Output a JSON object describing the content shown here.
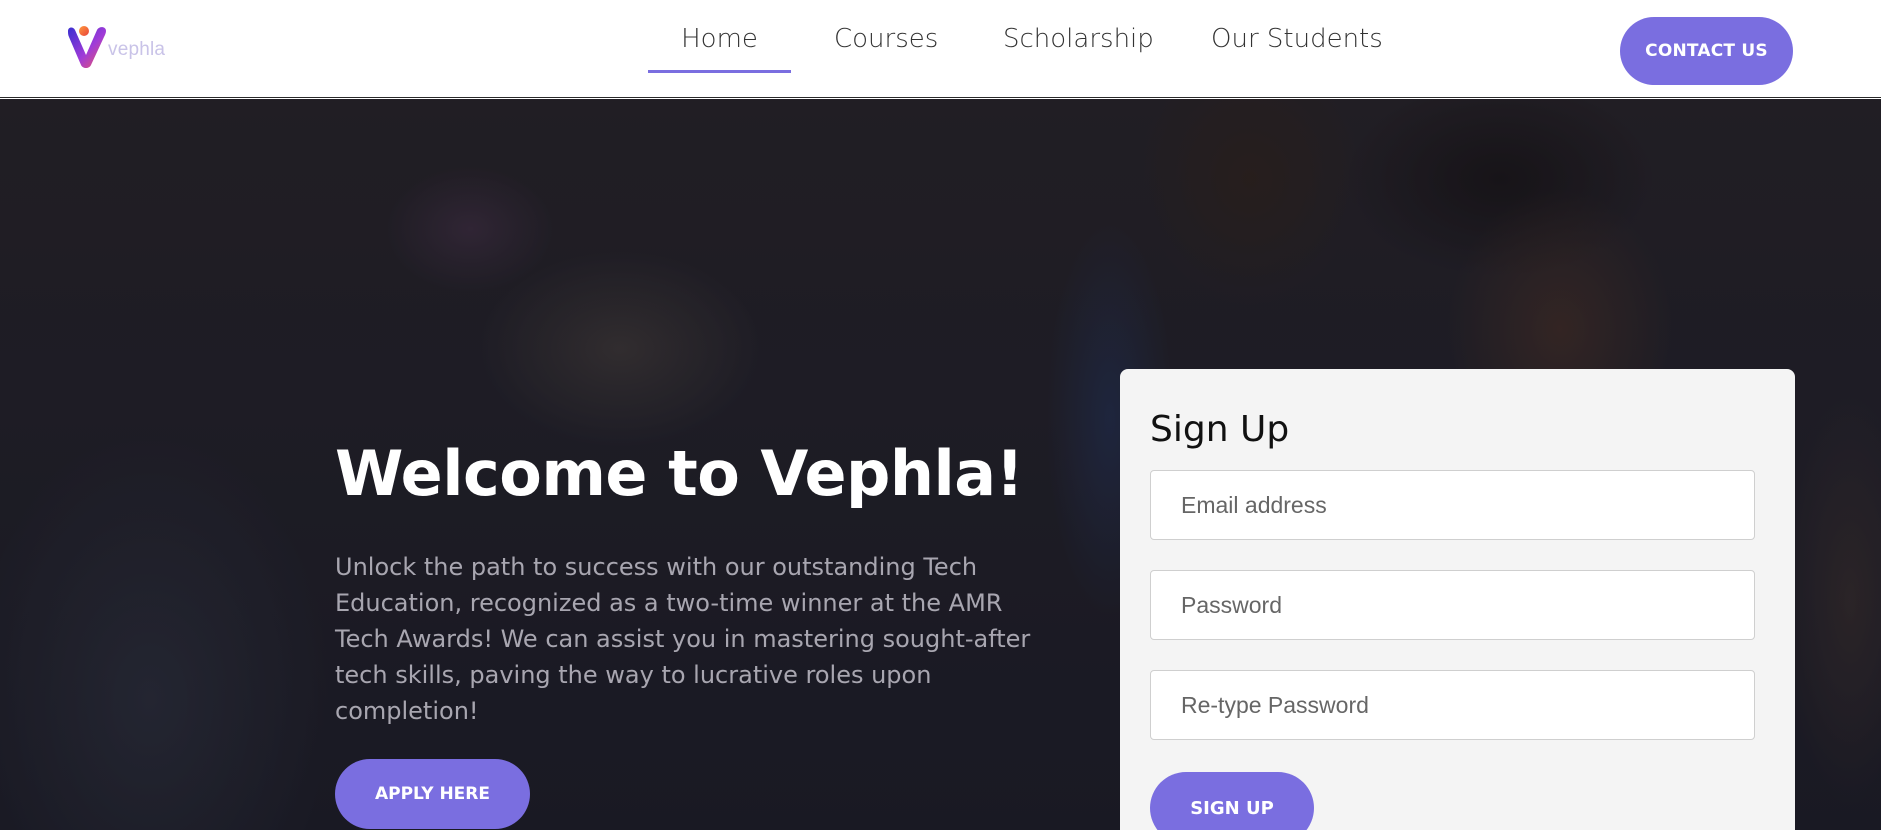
{
  "header": {
    "logo_text": "vephla",
    "nav": [
      {
        "label": "Home",
        "active": true
      },
      {
        "label": "Courses",
        "active": false
      },
      {
        "label": "Scholarship",
        "active": false
      },
      {
        "label": "Our Students",
        "active": false
      }
    ],
    "contact_label": "CONTACT US"
  },
  "hero": {
    "title": "Welcome to Vephla!",
    "description": "Unlock the path to success with our outstanding Tech Education, recognized as a two-time winner at the AMR Tech Awards! We can assist you in mastering sought-after tech skills, paving the way to lucrative roles upon completion!",
    "apply_label": "APPLY HERE"
  },
  "signup": {
    "title": "Sign Up",
    "email_placeholder": "Email address",
    "password_placeholder": "Password",
    "retype_placeholder": "Re-type Password",
    "submit_label": "SIGN UP"
  },
  "colors": {
    "accent": "#7a6ee0",
    "header_bg": "#ffffff",
    "card_bg": "#f4f4f4"
  }
}
